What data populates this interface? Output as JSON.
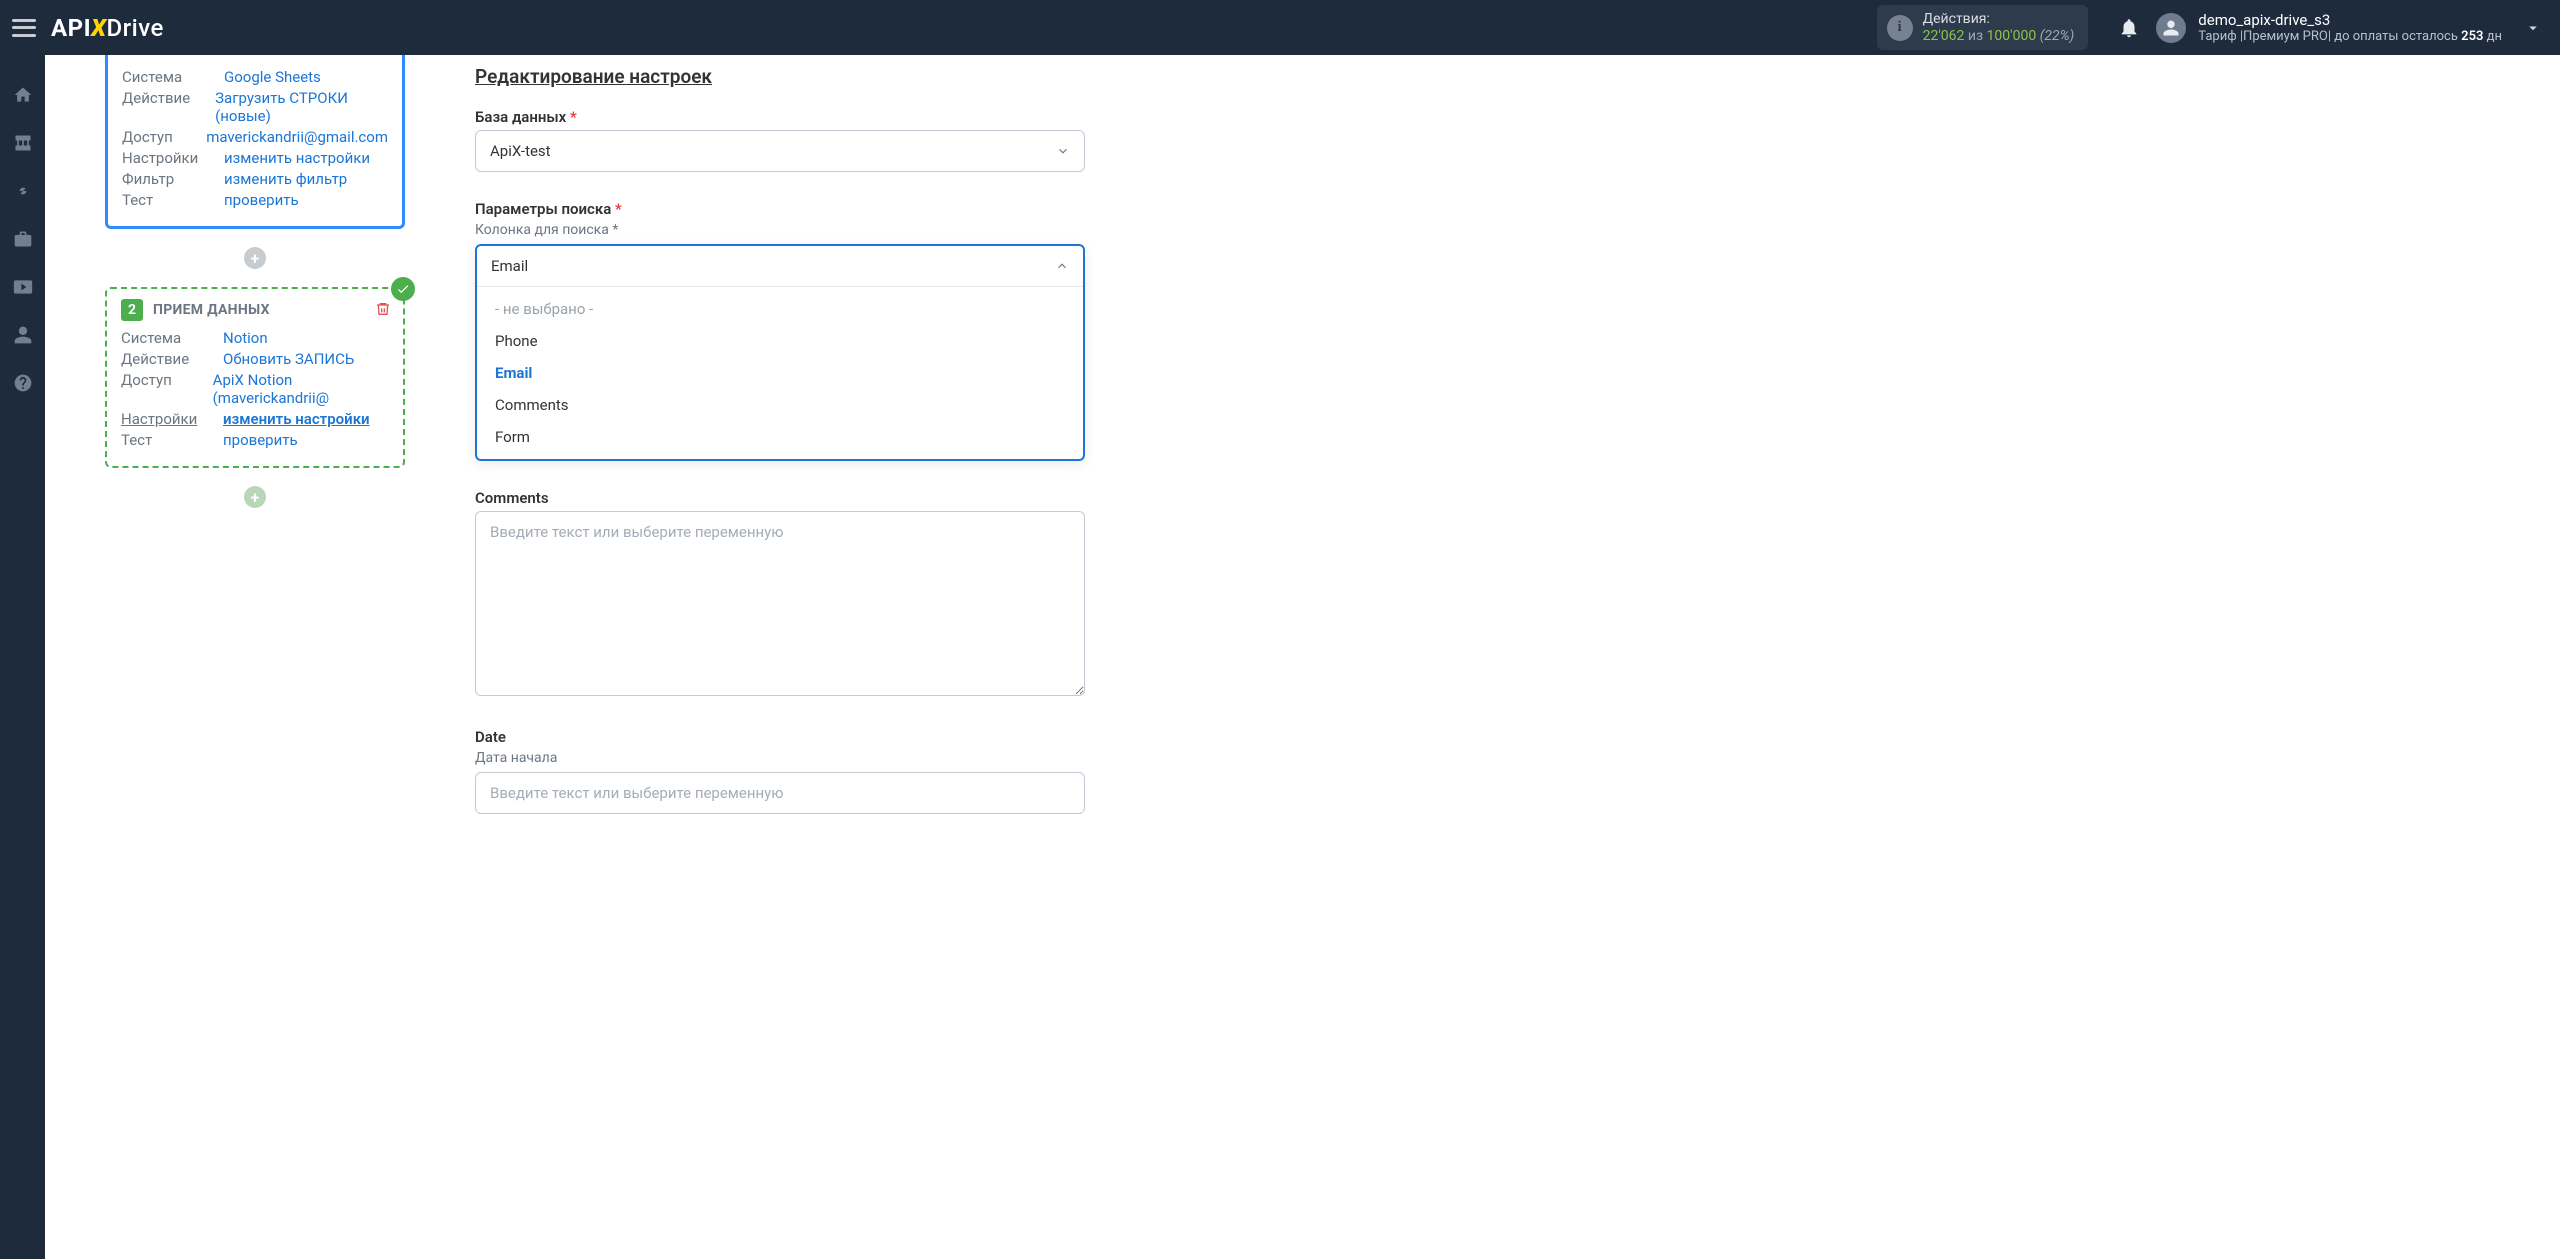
{
  "header": {
    "actions_label": "Действия:",
    "actions_count": "22'062",
    "actions_of": "из",
    "actions_total": "100'000",
    "actions_pct": "(22%)",
    "user_name": "demo_apix-drive_s3",
    "plan_prefix": "Тариф |Премиум PRO| до оплаты осталось ",
    "plan_days_num": "253",
    "plan_days_suffix": " дн"
  },
  "step1": {
    "system_k": "Система",
    "system_v": "Google Sheets",
    "action_k": "Действие",
    "action_v": "Загрузить СТРОКИ (новые)",
    "access_k": "Доступ",
    "access_v": "maverickandrii@gmail.com",
    "settings_k": "Настройки",
    "settings_v": "изменить настройки",
    "filter_k": "Фильтр",
    "filter_v": "изменить фильтр",
    "test_k": "Тест",
    "test_v": "проверить"
  },
  "step2": {
    "badge": "2",
    "title": "ПРИЕМ ДАННЫХ",
    "system_k": "Система",
    "system_v": "Notion",
    "action_k": "Действие",
    "action_v": "Обновить ЗАПИСЬ",
    "access_k": "Доступ",
    "access_v": "ApiX Notion (maverickandrii@",
    "settings_k": "Настройки",
    "settings_v": "изменить настройки",
    "test_k": "Тест",
    "test_v": "проверить"
  },
  "form": {
    "title": "Редактирование настроек",
    "db_label": "База данных",
    "db_value": "ApiX-test",
    "search_params_label": "Параметры поиска",
    "search_col_label": "Колонка для поиска *",
    "search_col_value": "Email",
    "options": {
      "none": "- не выбрано -",
      "phone": "Phone",
      "email": "Email",
      "comments": "Comments",
      "form": "Form"
    },
    "comments_label": "Comments",
    "comments_placeholder": "Введите текст или выберите переменную",
    "date_label": "Date",
    "date_start_label": "Дата начала",
    "date_placeholder": "Введите текст или выберите переменную"
  }
}
